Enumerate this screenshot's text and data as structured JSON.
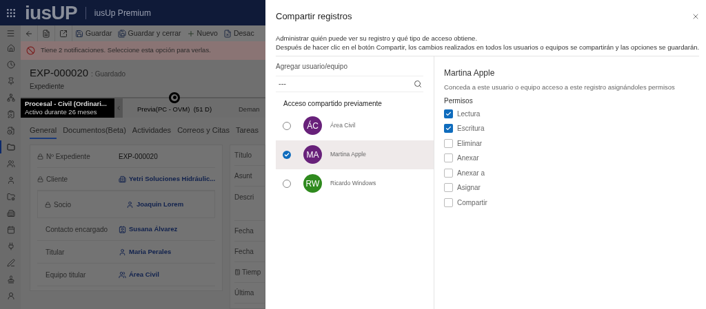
{
  "app": {
    "logo": "iusUP",
    "title": "iusUp Premium"
  },
  "sidebar": {
    "items": [
      {
        "selected": false
      },
      {
        "selected": false
      },
      {
        "selected": false
      },
      {
        "selected": false
      },
      {
        "selected": false
      },
      {
        "selected": false
      },
      {
        "selected": true
      },
      {
        "selected": false
      },
      {
        "selected": false
      },
      {
        "selected": false
      },
      {
        "selected": false
      },
      {
        "selected": false
      },
      {
        "selected": false
      },
      {
        "selected": false
      },
      {
        "selected": false
      },
      {
        "selected": false
      }
    ]
  },
  "toolbar": [
    {
      "kind": "save",
      "label": "Guardar"
    },
    {
      "kind": "saveclose",
      "label": "Guardar y cerrar"
    },
    {
      "kind": "new",
      "label": "Nuevo"
    },
    {
      "kind": "deactivate",
      "label": "Desac"
    }
  ],
  "notification": "Tiene 2 notificaciones. Seleccione esta opción para verlas.",
  "record": {
    "id": "EXP-000020",
    "status": ": Guardado",
    "entity": "Expediente"
  },
  "process": {
    "name": "Procesal - Civil (Ordinari...",
    "duration": "Activo durante 26 meses",
    "stages": [
      {
        "label": "Previa(PC - OVM)  (51 D)",
        "selected": true
      },
      {
        "label": "Deman",
        "selected": false
      }
    ]
  },
  "tabs": [
    {
      "label": "General",
      "selected": true
    },
    {
      "label": "Documentos(Beta)",
      "selected": false
    },
    {
      "label": "Actividades",
      "selected": false
    },
    {
      "label": "Correos y Citas",
      "selected": false
    },
    {
      "label": "Tareas",
      "selected": false
    }
  ],
  "fields": [
    {
      "label": "Nº Expediente",
      "locked": true,
      "kind": "text",
      "value": "EXP-000020"
    },
    {
      "label": "Cliente",
      "locked": true,
      "kind": "account",
      "value": "Yetri Soluciones Hidráulic..."
    },
    {
      "label": "Socio",
      "locked": true,
      "kind": "user",
      "value": "Joaquin Lorem"
    },
    {
      "label": "Contacto encargado",
      "locked": false,
      "kind": "contact",
      "value": "Susana Álvarez"
    },
    {
      "label": "Titular",
      "locked": false,
      "kind": "user",
      "value": "Maria Perales"
    },
    {
      "label": "Equipo titular",
      "locked": false,
      "kind": "team",
      "value": "Área Civil"
    }
  ],
  "fields_right": [
    {
      "label": "Título",
      "kind": "short"
    },
    {
      "label": "Asunt",
      "kind": "short"
    },
    {
      "label": "Descri",
      "kind": "tall"
    },
    {
      "label": "Fecha",
      "kind": "short"
    },
    {
      "label": "Fecha",
      "kind": "short"
    },
    {
      "label": "Tiemp",
      "kind": "calc"
    },
    {
      "label": "Última",
      "kind": "short"
    }
  ],
  "dialog": {
    "title": "Compartir registros",
    "description": [
      "Administrar quién puede ver su registro y qué tipo de acceso obtiene.",
      "Después de hacer clic en el botón Compartir, los cambios realizados en todos los usuarios o equipos se compartirán y las opciones se guardarán."
    ],
    "add_label": "Agregar usuario/equipo",
    "search_value": "---",
    "shared_heading": "Acceso compartido previamente",
    "shared": [
      {
        "initials": "ÁC",
        "name": "Área Civil",
        "color": "#68217a",
        "selected": false
      },
      {
        "initials": "MA",
        "name": "Martina Apple",
        "color": "#68217a",
        "selected": true
      },
      {
        "initials": "RW",
        "name": "Ricardo Windows",
        "color": "#2f8a1e",
        "selected": false
      }
    ],
    "detail": {
      "name": "Martina Apple",
      "hint": "Conceda a este usuario o equipo acceso a este registro asignándoles permisos",
      "permissions_label": "Permisos",
      "permissions": [
        {
          "label": "Lectura",
          "checked": true
        },
        {
          "label": "Escritura",
          "checked": true
        },
        {
          "label": "Eliminar",
          "checked": false
        },
        {
          "label": "Anexar",
          "checked": false
        },
        {
          "label": "Anexar a",
          "checked": false
        },
        {
          "label": "Asignar",
          "checked": false
        },
        {
          "label": "Compartir",
          "checked": false
        }
      ]
    }
  }
}
